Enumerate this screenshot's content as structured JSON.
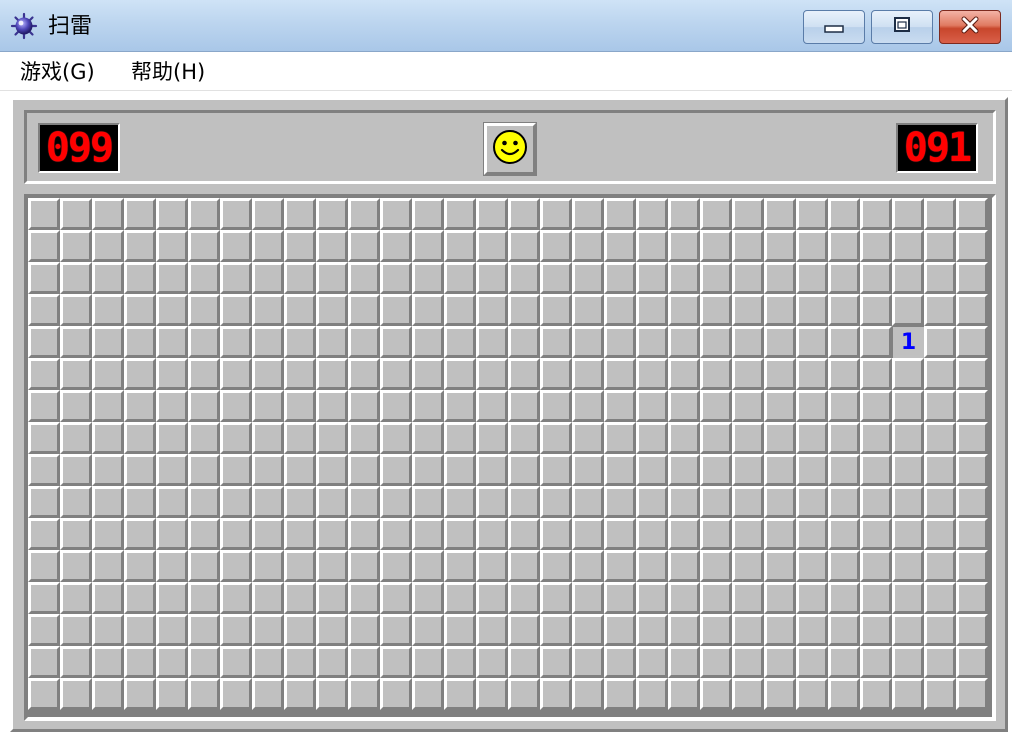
{
  "window": {
    "title": "扫雷",
    "icon": "mine-icon",
    "buttons": [
      "minimize-icon",
      "maximize-icon",
      "close-icon"
    ]
  },
  "menu": {
    "items": [
      {
        "label": "游戏(G)"
      },
      {
        "label": "帮助(H)"
      }
    ]
  },
  "status": {
    "mines_remaining": "099",
    "timer": "091",
    "face": "smiley-face-icon"
  },
  "board": {
    "columns": 30,
    "rows": 16,
    "revealed": [
      {
        "row": 4,
        "col": 27,
        "value": "1",
        "color": "#0000ff"
      }
    ]
  },
  "colors": {
    "board_gray": "#c0c0c0",
    "lcd_red": "#ff0000",
    "number_1": "#0000ff"
  }
}
